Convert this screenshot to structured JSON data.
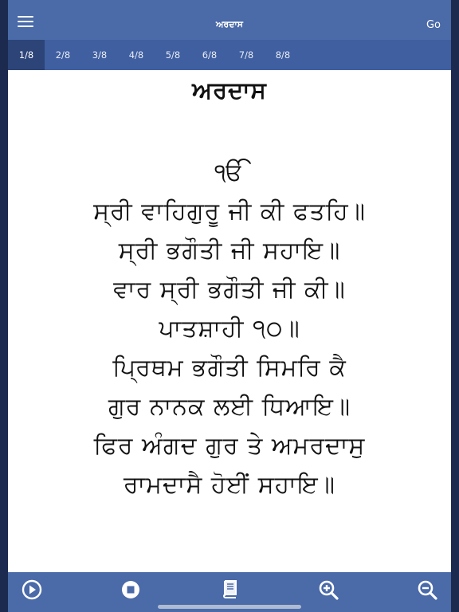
{
  "app": {
    "title": "ਅਰਦਾਸ",
    "go_label": "Go"
  },
  "tabs": [
    {
      "label": "1/8",
      "active": true
    },
    {
      "label": "2/8"
    },
    {
      "label": "3/8"
    },
    {
      "label": "4/8"
    },
    {
      "label": "5/8"
    },
    {
      "label": "6/8"
    },
    {
      "label": "7/8"
    },
    {
      "label": "8/8"
    }
  ],
  "content": {
    "heading": "ਅਰਦਾਸ",
    "lines": [
      "ੴ",
      "ਸ੍ਰੀ ਵਾਹਿਗੁਰੂ ਜੀ ਕੀ ਫਤਹਿ॥",
      "ਸ੍ਰੀ ਭਗੌਤੀ ਜੀ ਸਹਾਇ॥",
      "ਵਾਰ ਸ੍ਰੀ ਭਗੌਤੀ ਜੀ ਕੀ॥",
      "ਪਾਤਸ਼ਾਹੀ ੧੦॥",
      "ਪ੍ਰਿਥਮ ਭਗੌਤੀ ਸਿਮਰਿ ਕੈ",
      "ਗੁਰ ਨਾਨਕ ਲਈ ਧਿਆਇ॥",
      "ਫਿਰ ਅੰਗਦ ਗੁਰ ਤੇ ਅਮਰਦਾਸੁ",
      "ਰਾਮਦਾਸੈ ਹੋਈਂ ਸਹਾਇ॥"
    ]
  },
  "icons": {
    "menu": "hamburger-menu-icon",
    "play": "play-icon",
    "stop": "stop-icon",
    "book": "book-icon",
    "zoom_in": "zoom-in-icon",
    "zoom_out": "zoom-out-icon"
  },
  "colors": {
    "bar": "#4a6aa8",
    "tabs": "#3f5fa0",
    "active_tab": "#2c4478"
  }
}
